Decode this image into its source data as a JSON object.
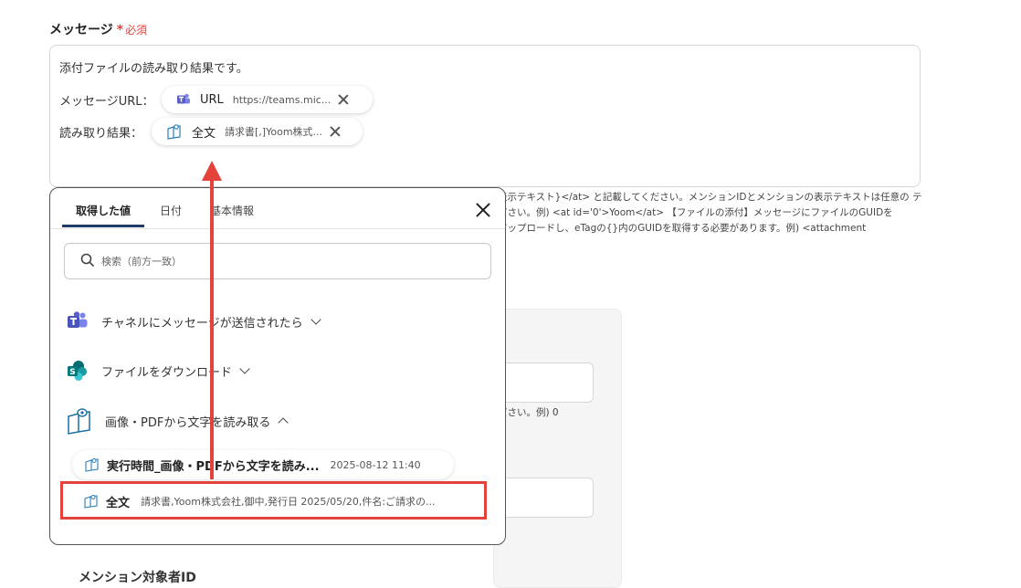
{
  "field": {
    "label": "メッセージ",
    "required_star": "*",
    "required_text": "必須"
  },
  "message": {
    "line1": "添付ファイルの読み取り結果です。",
    "url_label": "メッセージURL：",
    "url_pill": {
      "title": "URL",
      "value": "https://teams.mic..."
    },
    "result_label": "読み取り結果：",
    "result_pill": {
      "title": "全文",
      "value": "請求書[,]Yoom株式..."
    }
  },
  "help": [
    "表示テキスト}</at> と記載してください。メンションIDとメンションの表示テキストは任意の テ",
    "ださい。例) <at id='0'>Yoom</at>  【ファイルの添付】メッセージにファイルのGUIDを",
    "アップロードし、eTagの{}内のGUIDを取得する必要があります。例) <attachment"
  ],
  "bg": {
    "note": "ださい。例) 0",
    "mention_label": "メンション対象者ID"
  },
  "popup": {
    "tabs": [
      "取得した値",
      "日付",
      "基本情報"
    ],
    "active_tab": 0,
    "search_placeholder": "検索（前方一致）",
    "sections": [
      {
        "title": "チャネルにメッセージが送信されたら",
        "icon": "teams-icon",
        "expanded": false
      },
      {
        "title": "ファイルをダウンロード",
        "icon": "sharepoint-icon",
        "expanded": false
      },
      {
        "title": "画像・PDFから文字を読み取る",
        "icon": "ocr-book-icon",
        "expanded": true
      }
    ],
    "items": [
      {
        "title": "実行時間_画像・PDFから文字を読み...",
        "value": "2025-08-12 11:40"
      },
      {
        "title": "全文",
        "value": "請求書,Yoom株式会社,御中,発行日 2025/05/20,件名:ご請求の..."
      }
    ]
  },
  "colors": {
    "accent_red": "#e4433b",
    "tab_underline": "#1f3b6b",
    "teams_purple": "#5b5fc7",
    "sharepoint_teal": "#03787c"
  }
}
